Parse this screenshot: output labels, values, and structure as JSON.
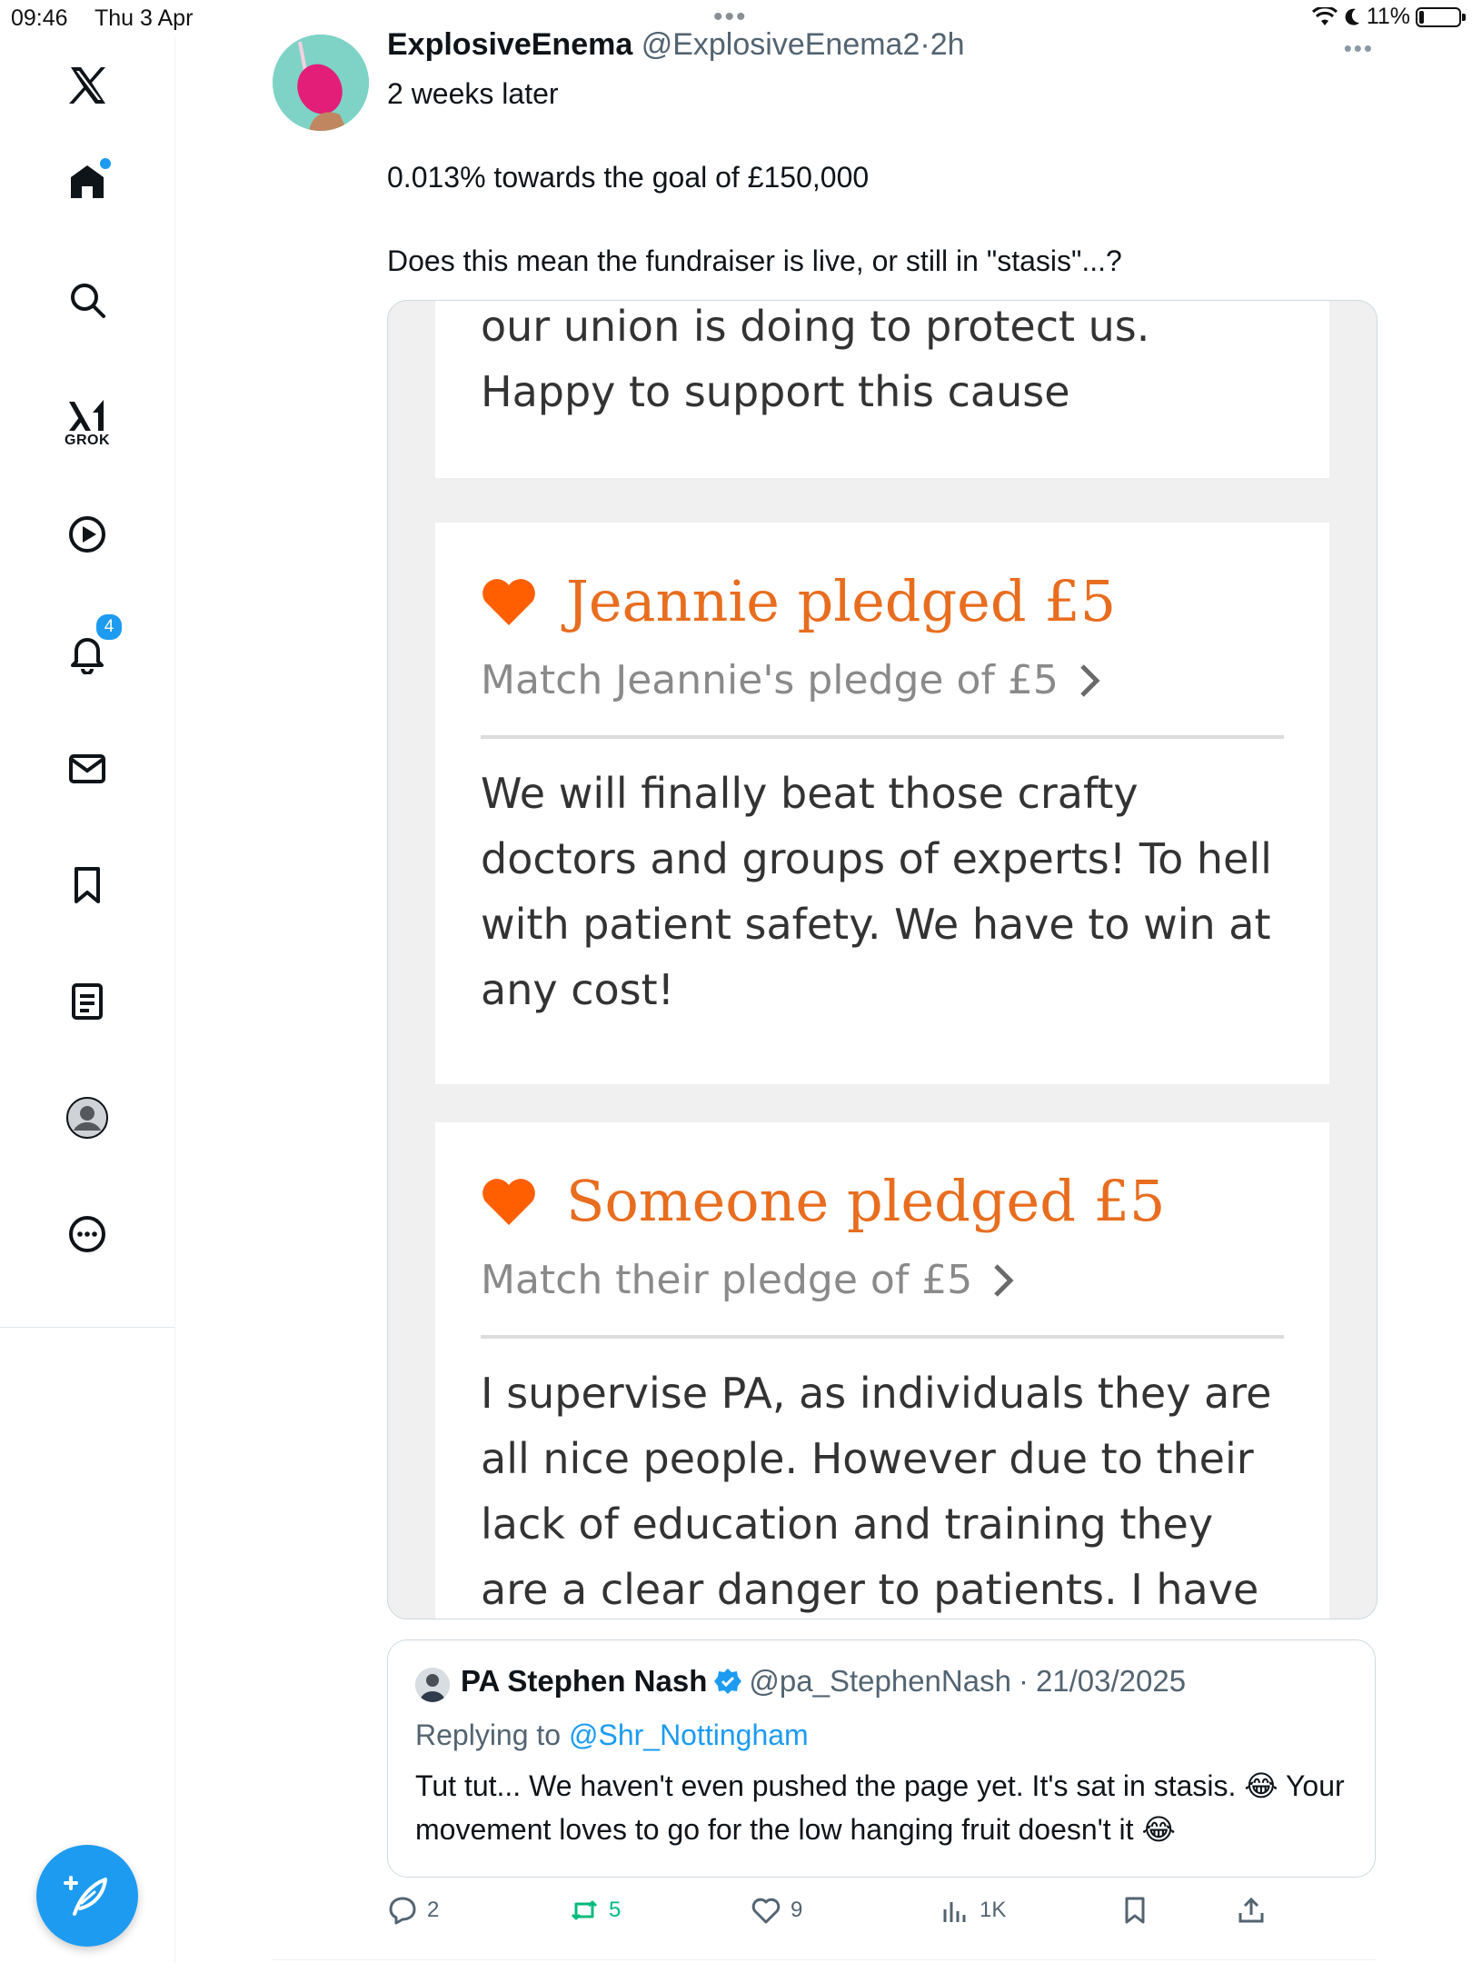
{
  "status_bar": {
    "time": "09:46",
    "date": "Thu 3 Apr",
    "battery": "11%",
    "battery_level": 0.11
  },
  "sidebar": {
    "items": [
      {
        "icon": "x-logo-icon"
      },
      {
        "icon": "home-icon",
        "has_dot": true
      },
      {
        "icon": "search-icon"
      },
      {
        "icon": "grok-icon",
        "label": "GROK"
      },
      {
        "icon": "video-icon"
      },
      {
        "icon": "bell-icon",
        "badge": "4"
      },
      {
        "icon": "mail-icon"
      },
      {
        "icon": "bookmark-icon"
      },
      {
        "icon": "list-icon"
      },
      {
        "icon": "profile-icon"
      },
      {
        "icon": "more-circle-icon"
      }
    ],
    "compose_icon": "compose-feather-icon"
  },
  "tweet": {
    "author_name": "ExplosiveEnema",
    "author_handle": "@ExplosiveEnema2",
    "separator": "·",
    "timestamp": "2h",
    "lines": [
      "2 weeks later",
      "0.013% towards the goal of £150,000",
      "Does this mean the fundraiser is live, or still in \"stasis\"...?"
    ]
  },
  "media": {
    "top_card_text": "our union is doing to protect us. Happy to support this cause",
    "pledges": [
      {
        "title": "Jeannie pledged £5",
        "match": "Match Jeannie's pledge of £5",
        "comment": "We will finally beat those crafty doctors and groups of experts! To hell with patient safety. We have to win at any cost!"
      },
      {
        "title": "Someone pledged £5",
        "match": "Match their pledge of £5",
        "comment": "I supervise PA, as individuals they are all nice people. However due to their lack of education and training they are a clear danger to patients. I have personally"
      }
    ],
    "accent_color": "#e86d1f"
  },
  "quote": {
    "name": "PA Stephen Nash",
    "verified": true,
    "handle": "@pa_StephenNash",
    "separator": "·",
    "date": "21/03/2025",
    "replying_prefix": "Replying to",
    "replying_to": "@Shr_Nottingham",
    "text": "Tut tut... We haven't even pushed the page yet. It's sat in stasis. 😂 Your movement loves to go for the low hanging fruit doesn't it 😂"
  },
  "actions": {
    "replies": "2",
    "retweets": "5",
    "likes": "9",
    "views": "1K"
  },
  "colors": {
    "brand_blue": "#1d9bf0",
    "retweet_green": "#00ba7c",
    "muted": "#536471"
  }
}
